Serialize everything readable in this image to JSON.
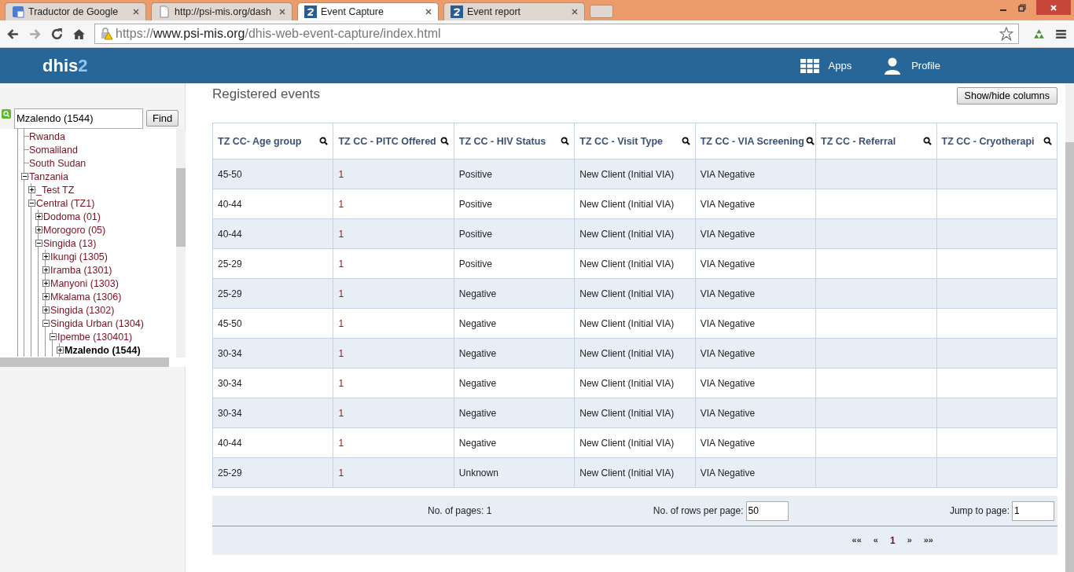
{
  "browser": {
    "tabs": [
      {
        "title": "Traductor de Google",
        "kind": "translate",
        "selected": false
      },
      {
        "title": "http://psi-mis.org/dash",
        "kind": "page",
        "selected": false
      },
      {
        "title": "Event Capture",
        "kind": "dhis",
        "selected": true
      },
      {
        "title": "Event report",
        "kind": "dhis",
        "selected": false
      }
    ],
    "url": {
      "scheme": "https://",
      "host": "www.psi-mis.org",
      "path": "/dhis-web-event-capture/index.html"
    }
  },
  "header": {
    "logo": {
      "main": "dhis",
      "accent": "2"
    },
    "nav": [
      {
        "label": "Apps",
        "kind": "apps"
      },
      {
        "label": "Profile",
        "kind": "profile"
      }
    ]
  },
  "sidebar": {
    "search": {
      "value": "Mzalendo (1544)",
      "button": "Find"
    },
    "tree": [
      {
        "label": "Rwanda",
        "kind": "leaf",
        "selected": false
      },
      {
        "label": "Somaliland",
        "kind": "leaf",
        "selected": false
      },
      {
        "label": "South Sudan",
        "kind": "leaf",
        "selected": false
      },
      {
        "label": "Tanzania",
        "kind": "node",
        "expanded": true,
        "selected": false,
        "children": [
          {
            "label": "_Test TZ",
            "kind": "node",
            "expanded": false,
            "selected": false
          },
          {
            "label": "Central (TZ1)",
            "kind": "node",
            "expanded": true,
            "selected": false,
            "children": [
              {
                "label": "Dodoma (01)",
                "kind": "node",
                "expanded": false,
                "selected": false
              },
              {
                "label": "Morogoro (05)",
                "kind": "node",
                "expanded": false,
                "selected": false
              },
              {
                "label": "Singida (13)",
                "kind": "node",
                "expanded": true,
                "selected": false,
                "children": [
                  {
                    "label": "Ikungi (1305)",
                    "kind": "node",
                    "expanded": false,
                    "selected": false
                  },
                  {
                    "label": "Iramba (1301)",
                    "kind": "node",
                    "expanded": false,
                    "selected": false
                  },
                  {
                    "label": "Manyoni (1303)",
                    "kind": "node",
                    "expanded": false,
                    "selected": false
                  },
                  {
                    "label": "Mkalama (1306)",
                    "kind": "node",
                    "expanded": false,
                    "selected": false
                  },
                  {
                    "label": "Singida (1302)",
                    "kind": "node",
                    "expanded": false,
                    "selected": false
                  },
                  {
                    "label": "Singida Urban (1304)",
                    "kind": "node",
                    "expanded": true,
                    "selected": false,
                    "children": [
                      {
                        "label": "Ipembe (130401)",
                        "kind": "node",
                        "expanded": true,
                        "selected": false,
                        "children": [
                          {
                            "label": "Mzalendo (1544)",
                            "kind": "node",
                            "expanded": false,
                            "selected": true
                          }
                        ]
                      }
                    ]
                  }
                ]
              }
            ]
          }
        ]
      }
    ]
  },
  "main": {
    "title": "Registered events",
    "columns_button": "Show/hide columns",
    "table": {
      "columns": [
        "TZ CC- Age group",
        "TZ CC - PITC Offered",
        "TZ CC - HIV Status",
        "TZ CC - Visit Type",
        "TZ CC - VIA Screening",
        "TZ CC - Referral",
        "TZ CC - Cryotherapi"
      ],
      "rows": [
        [
          "45-50",
          "1",
          "Positive",
          "New Client (Initial VIA)",
          "VIA Negative"
        ],
        [
          "40-44",
          "1",
          "Positive",
          "New Client (Initial VIA)",
          "VIA Negative"
        ],
        [
          "40-44",
          "1",
          "Positive",
          "New Client (Initial VIA)",
          "VIA Negative"
        ],
        [
          "25-29",
          "1",
          "Positive",
          "New Client (Initial VIA)",
          "VIA Negative"
        ],
        [
          "25-29",
          "1",
          "Negative",
          "New Client (Initial VIA)",
          "VIA Negative"
        ],
        [
          "45-50",
          "1",
          "Negative",
          "New Client (Initial VIA)",
          "VIA Negative"
        ],
        [
          "30-34",
          "1",
          "Negative",
          "New Client (Initial VIA)",
          "VIA Negative"
        ],
        [
          "30-34",
          "1",
          "Negative",
          "New Client (Initial VIA)",
          "VIA Negative"
        ],
        [
          "30-34",
          "1",
          "Negative",
          "New Client (Initial VIA)",
          "VIA Negative"
        ],
        [
          "40-44",
          "1",
          "Negative",
          "New Client (Initial VIA)",
          "VIA Negative"
        ],
        [
          "25-29",
          "1",
          "Unknown",
          "New Client (Initial VIA)",
          "VIA Negative"
        ]
      ]
    },
    "pager": {
      "pages_label": "No. of pages: 1",
      "rows_label": "No. of rows per page:",
      "rows_value": "50",
      "jump_label": "Jump to page:",
      "jump_value": "1",
      "links": [
        {
          "label": "««",
          "selected": false
        },
        {
          "label": "«",
          "selected": false
        },
        {
          "label": "1",
          "selected": true
        },
        {
          "label": "»",
          "selected": false
        },
        {
          "label": "»»",
          "selected": false
        }
      ]
    }
  }
}
